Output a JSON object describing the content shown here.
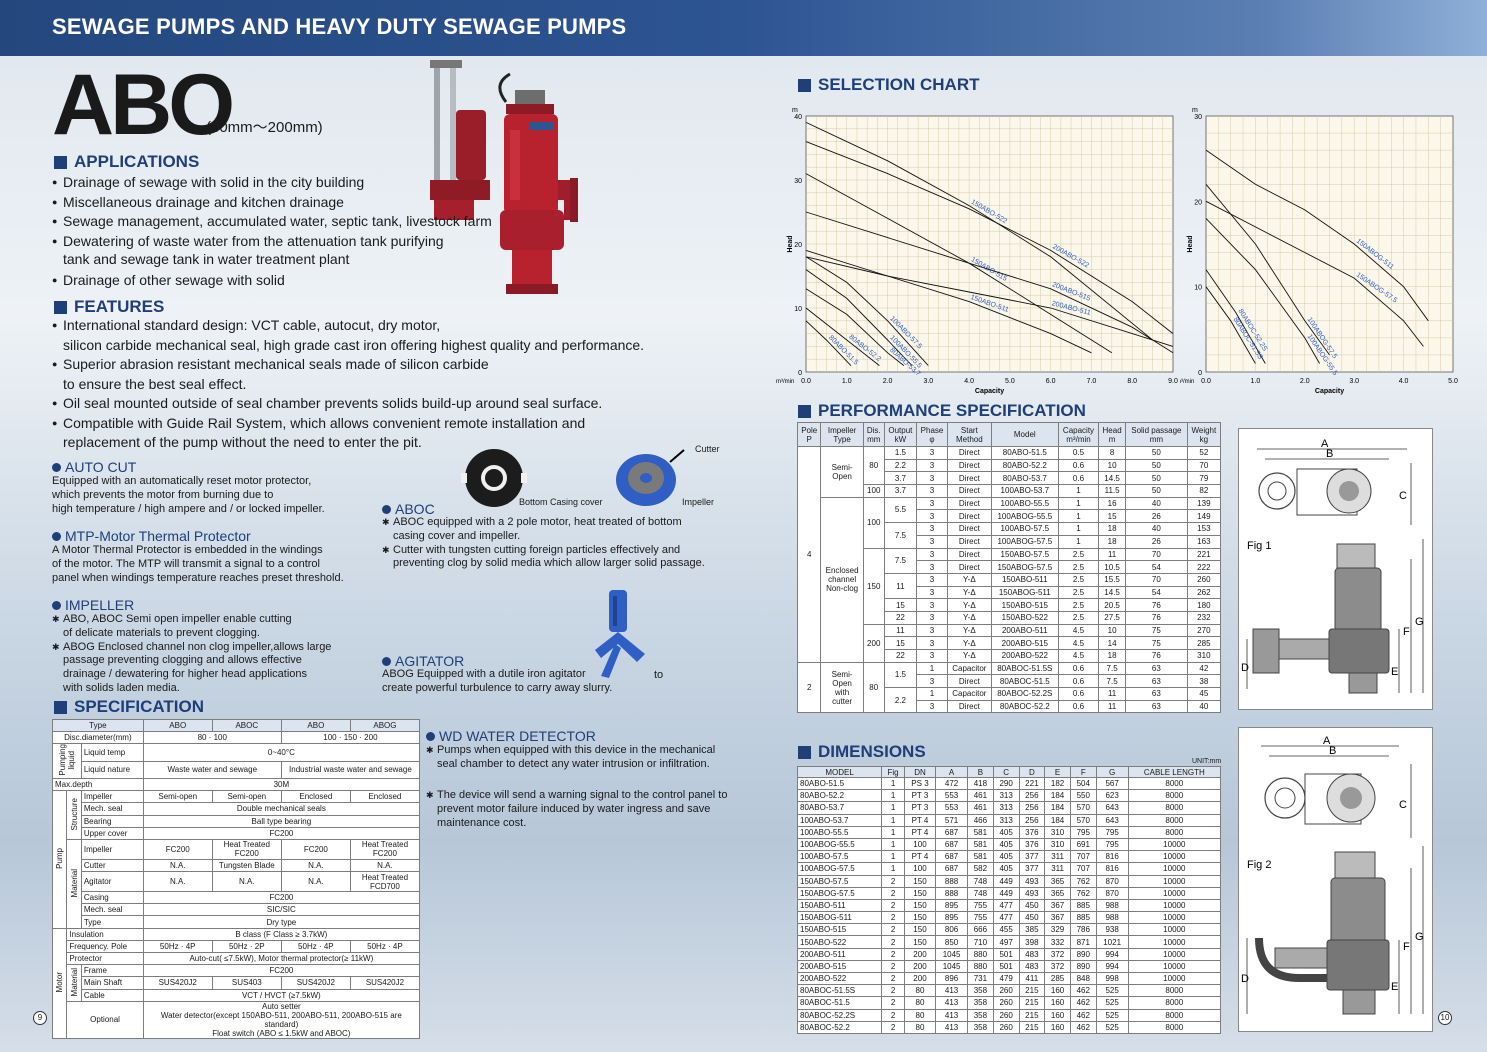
{
  "header": {
    "title": "SEWAGE PUMPS AND HEAVY DUTY SEWAGE PUMPS"
  },
  "model": {
    "name": "ABO",
    "range": "(80mm～200mm)"
  },
  "applications": {
    "title": "APPLICATIONS",
    "items": [
      "Drainage of sewage with solid in the city building",
      "Miscellaneous drainage and kitchen drainage",
      "Sewage management, accumulated water, septic tank, livestock farm",
      "Dewatering of waste water from the attenuation tank purifying",
      "Drainage of other sewage with solid"
    ],
    "item4_cont": "tank and sewage tank in water treatment plant"
  },
  "features": {
    "title": "FEATURES",
    "items": [
      "International standard design: VCT cable, autocut, dry motor,",
      "Superior abrasion resistant mechanical seals made of silicon carbide",
      "Oil seal mounted outside of seal chamber prevents solids build-up around seal surface.",
      "Compatible with Guide Rail System, which allows convenient remote installation and"
    ],
    "cont1": "silicon carbide mechanical seal, high grade cast iron offering highest quality and performance.",
    "cont2": "to ensure the best seal effect.",
    "cont4": "replacement of the pump without the need to enter the pit."
  },
  "autocut": {
    "title": "AUTO CUT",
    "lines": [
      "Equipped with an automatically reset motor protector,",
      "which prevents the motor from burning due to",
      "high temperature / high ampere and / or locked impeller."
    ]
  },
  "mtp": {
    "title": "MTP-Motor Thermal Protector",
    "lines": [
      "A Motor Thermal Protector is embedded in the windings",
      "of the motor. The MTP will transmit a signal to a control",
      "panel when windings temperature reaches preset threshold."
    ]
  },
  "impeller": {
    "title": "IMPELLER",
    "lines": [
      "ABO, ABOC Semi open impeller enable cutting",
      "of delicate materials to prevent clogging.",
      "ABOG Enclosed channel non clog impeller,allows large",
      "passage preventing clogging and allows effective",
      "drainage / dewatering for higher head applications",
      "with solids laden media."
    ]
  },
  "aboc": {
    "title": "ABOC",
    "lines": [
      "ABOC equipped with a 2 pole motor, heat treated of bottom",
      "casing cover and impeller.",
      "Cutter with tungsten cutting foreign particles effectively and",
      "preventing clog by solid media which allow larger solid passage."
    ],
    "label_cover": "Bottom Casing cover",
    "label_cutter": "Cutter",
    "label_impeller": "Impeller"
  },
  "agitator": {
    "title": "AGITATOR",
    "lines": [
      "ABOG Equipped with a dutile iron agitator",
      "create powerful turbulence to carry away slurry."
    ],
    "to": "to"
  },
  "wd": {
    "title": "WD WATER DETECTOR",
    "lines": [
      "Pumps when equipped with this device in the mechanical",
      "seal chamber to detect any water intrusion or infiltration.",
      "The device will send a warning signal to the control panel to",
      "prevent motor failure induced by water ingress and save",
      "maintenance cost."
    ]
  },
  "specification": {
    "title": "SPECIFICATION",
    "head": [
      "Type",
      "ABO",
      "ABOC",
      "ABO",
      "ABOG"
    ],
    "disc_label": "Disc.diameter(mm)",
    "disc_a": "80 · 100",
    "disc_b": "100 · 150 · 200",
    "pumping_liquid": "Pumping liquid",
    "liquid_temp": "Liquid temp",
    "liquid_temp_v": "0~40°C",
    "liquid_nature": "Liquid nature",
    "liquid_nature_a": "Waste water and sewage",
    "liquid_nature_b": "Industrial waste water and sewage",
    "max_depth": "Max.depth",
    "max_depth_v": "30M",
    "pump": "Pump",
    "structure": "Structure",
    "material": "Material",
    "impeller_s": "Impeller",
    "impeller_s_v": [
      "Semi-open",
      "Semi-open",
      "Enclosed",
      "Enclosed"
    ],
    "mech_seal": "Mech. seal",
    "mech_seal_v": "Double mechanical seals",
    "bearing": "Bearing",
    "bearing_v": "Ball type bearing",
    "upper_cover": "Upper cover",
    "upper_cover_v": "FC200",
    "impeller_m": "Impeller",
    "impeller_m_v": [
      "FC200",
      "Heat Treated FC200",
      "FC200",
      "Heat Treated FC200"
    ],
    "cutter": "Cutter",
    "cutter_v": [
      "N.A.",
      "Tungsten Blade",
      "N.A.",
      "N.A."
    ],
    "agitator_m": "Agitator",
    "agitator_m_v": [
      "N.A.",
      "N.A.",
      "N.A.",
      "Heat Treated FCD700"
    ],
    "casing": "Casing",
    "casing_v": "FC200",
    "mech_seal_m": "Mech. seal",
    "mech_seal_m_v": "SIC/SIC",
    "motor": "Motor",
    "type": "Type",
    "type_v": "Dry type",
    "insulation": "Insulation",
    "insulation_v": "B class (F Class ≥ 3.7kW)",
    "freq": "Frequency. Pole",
    "freq_v": [
      "50Hz · 4P",
      "50Hz · 2P",
      "50Hz · 4P",
      "50Hz · 4P"
    ],
    "protector": "Protector",
    "protector_v": "Auto-cut( ≤7.5kW), Motor thermal protector(≥ 11kW)",
    "frame": "Frame",
    "frame_v": "FC200",
    "main_shaft": "Main Shaft",
    "main_shaft_v": [
      "SUS420J2",
      "SUS403",
      "SUS420J2",
      "SUS420J2"
    ],
    "cable": "Cable",
    "cable_v": "VCT / HVCT (≥7.5kW)",
    "optional": "Optional",
    "optional_v": [
      "Auto setter",
      "Water detector(except 150ABO-511, 200ABO-511, 200ABO-515 are standard)",
      "Float switch (ABO ≤ 1.5kW and ABOC)"
    ]
  },
  "selection_chart": {
    "title": "SELECTION CHART"
  },
  "chart_data": [
    {
      "type": "line",
      "xlabel": "Capacity",
      "ylabel": "Head",
      "x_unit": "m³/min",
      "y_unit": "m",
      "xlim": [
        0,
        9
      ],
      "ylim": [
        0,
        40
      ],
      "x_ticks": [
        "0.0",
        "1.0",
        "2.0",
        "3.0",
        "4.0",
        "5.0",
        "6.0",
        "7.0",
        "8.0",
        "9.0"
      ],
      "y_ticks": [
        "0",
        "10",
        "20",
        "30",
        "40"
      ],
      "series": [
        {
          "name": "150ABO-522",
          "x": [
            0,
            2,
            4,
            6,
            8.5
          ],
          "y": [
            39,
            33,
            26,
            18,
            5
          ]
        },
        {
          "name": "200ABO-522",
          "x": [
            0,
            2,
            4,
            6,
            8,
            9
          ],
          "y": [
            36,
            31,
            25.5,
            19,
            11,
            6
          ]
        },
        {
          "name": "150ABO-515",
          "x": [
            0,
            2,
            4,
            6,
            7.5
          ],
          "y": [
            31,
            24,
            17,
            9,
            3
          ]
        },
        {
          "name": "200ABO-515",
          "x": [
            0,
            2,
            4,
            6,
            8,
            9
          ],
          "y": [
            25,
            21,
            17,
            13,
            7,
            3
          ]
        },
        {
          "name": "200ABO-511",
          "x": [
            0,
            2,
            4,
            6,
            8,
            9
          ],
          "y": [
            18,
            15,
            12.5,
            10,
            6,
            4
          ]
        },
        {
          "name": "150ABO-511",
          "x": [
            0,
            2,
            4,
            6,
            7
          ],
          "y": [
            19,
            15,
            11,
            6,
            3
          ]
        },
        {
          "name": "100ABO-57.5",
          "x": [
            0,
            1,
            2,
            3
          ],
          "y": [
            18,
            14,
            8,
            1
          ]
        },
        {
          "name": "100ABO-55.5",
          "x": [
            0,
            1,
            2,
            2.6
          ],
          "y": [
            16,
            11.5,
            5,
            1
          ]
        },
        {
          "name": "80ABO-53.7",
          "x": [
            0,
            1,
            2,
            2.4
          ],
          "y": [
            13,
            9,
            3,
            1
          ]
        },
        {
          "name": "80ABO-52.2",
          "x": [
            0,
            1,
            1.8
          ],
          "y": [
            10,
            5,
            1
          ]
        },
        {
          "name": "80ABO-51.5",
          "x": [
            0,
            0.5,
            1.1
          ],
          "y": [
            8,
            5,
            1
          ]
        }
      ]
    },
    {
      "type": "line",
      "xlabel": "Capacity",
      "ylabel": "Head",
      "x_unit": "m³/min",
      "y_unit": "m",
      "xlim": [
        0,
        5
      ],
      "ylim": [
        0,
        30
      ],
      "x_ticks": [
        "0.0",
        "1.0",
        "2.0",
        "3.0",
        "4.0",
        "5.0"
      ],
      "y_ticks": [
        "0",
        "10",
        "20",
        "30"
      ],
      "series": [
        {
          "name": "150ABOG-511",
          "x": [
            0,
            1,
            2,
            3,
            4,
            4.5
          ],
          "y": [
            26,
            22,
            19,
            15,
            10,
            6
          ]
        },
        {
          "name": "150ABOG-57.5",
          "x": [
            0,
            1,
            2,
            3,
            4,
            4.4
          ],
          "y": [
            20,
            17,
            14,
            11,
            6,
            3
          ]
        },
        {
          "name": "100ABOG-57.5",
          "x": [
            0,
            1,
            2,
            2.5
          ],
          "y": [
            22,
            15,
            6,
            2
          ]
        },
        {
          "name": "100ABOG-55.5",
          "x": [
            0,
            1,
            2,
            2.3
          ],
          "y": [
            18,
            12,
            4,
            1
          ]
        },
        {
          "name": "80ABOC-52.2S",
          "x": [
            0,
            0.6,
            1.2
          ],
          "y": [
            12,
            7,
            1
          ]
        },
        {
          "name": "80ABOC-51.5S",
          "x": [
            0,
            0.5,
            1.0
          ],
          "y": [
            10,
            6,
            1
          ]
        }
      ]
    }
  ],
  "performance": {
    "title": "PERFORMANCE SPECIFICATION",
    "headers": [
      [
        "Pole",
        "P"
      ],
      [
        "Impeller",
        "Type"
      ],
      [
        "Dis.",
        "mm"
      ],
      [
        "Output",
        "kW"
      ],
      [
        "Phase",
        "φ"
      ],
      [
        "Start",
        "Method"
      ],
      [
        "Model",
        ""
      ],
      [
        "Capacity",
        "m³/min"
      ],
      [
        "Head",
        "m"
      ],
      [
        "Solid passage",
        "mm"
      ],
      [
        "Weight",
        "kg"
      ]
    ],
    "pole4": "4",
    "pole2": "2",
    "semi_open": [
      "Semi-",
      "Open"
    ],
    "enclosed": [
      "Enclosed",
      "channel",
      "Non-clog"
    ],
    "semi_open_cutter": [
      "Semi-",
      "Open",
      "with",
      "cutter"
    ],
    "rows": [
      [
        "1.5",
        "3",
        "Direct",
        "80ABO-51.5",
        "0.5",
        "8",
        "50",
        "52"
      ],
      [
        "2.2",
        "3",
        "Direct",
        "80ABO-52.2",
        "0.6",
        "10",
        "50",
        "70"
      ],
      [
        "3.7",
        "3",
        "Direct",
        "80ABO-53.7",
        "0.6",
        "14.5",
        "50",
        "79"
      ],
      [
        "3.7",
        "3",
        "Direct",
        "100ABO-53.7",
        "1",
        "11.5",
        "50",
        "82"
      ],
      [
        "",
        "3",
        "Direct",
        "100ABO-55.5",
        "1",
        "16",
        "40",
        "139"
      ],
      [
        "",
        "3",
        "Direct",
        "100ABOG-55.5",
        "1",
        "15",
        "26",
        "149"
      ],
      [
        "",
        "3",
        "Direct",
        "100ABO-57.5",
        "1",
        "18",
        "40",
        "153"
      ],
      [
        "",
        "3",
        "Direct",
        "100ABOG-57.5",
        "1",
        "18",
        "26",
        "163"
      ],
      [
        "",
        "3",
        "Direct",
        "150ABO-57.5",
        "2.5",
        "11",
        "70",
        "221"
      ],
      [
        "",
        "3",
        "Direct",
        "150ABOG-57.5",
        "2.5",
        "10.5",
        "54",
        "222"
      ],
      [
        "",
        "3",
        "Y-Δ",
        "150ABO-511",
        "2.5",
        "15.5",
        "70",
        "260"
      ],
      [
        "",
        "3",
        "Y-Δ",
        "150ABOG-511",
        "2.5",
        "14.5",
        "54",
        "262"
      ],
      [
        "15",
        "3",
        "Y-Δ",
        "150ABO-515",
        "2.5",
        "20.5",
        "76",
        "180"
      ],
      [
        "22",
        "3",
        "Y-Δ",
        "150ABO-522",
        "2.5",
        "27.5",
        "76",
        "232"
      ],
      [
        "11",
        "3",
        "Y-Δ",
        "200ABO-511",
        "4.5",
        "10",
        "75",
        "270"
      ],
      [
        "15",
        "3",
        "Y-Δ",
        "200ABO-515",
        "4.5",
        "14",
        "75",
        "285"
      ],
      [
        "22",
        "3",
        "Y-Δ",
        "200ABO-522",
        "4.5",
        "18",
        "76",
        "310"
      ],
      [
        "",
        "1",
        "Capacitor",
        "80ABOC-51.5S",
        "0.6",
        "7.5",
        "63",
        "42"
      ],
      [
        "",
        "3",
        "Direct",
        "80ABOC-51.5",
        "0.6",
        "7.5",
        "63",
        "38"
      ],
      [
        "",
        "1",
        "Capacitor",
        "80ABOC-52.2S",
        "0.6",
        "11",
        "63",
        "45"
      ],
      [
        "",
        "3",
        "Direct",
        "80ABOC-52.2",
        "0.6",
        "11",
        "63",
        "40"
      ]
    ],
    "dis_80": "80",
    "dis_100": "100",
    "dis_150": "150",
    "dis_200": "200",
    "out_55": "5.5",
    "out_75": "7.5",
    "out_75b": "7.5",
    "out_11": "11",
    "out_15c": "1.5",
    "out_22c": "2.2"
  },
  "dimensions": {
    "title": "DIMENSIONS",
    "unit": "UNIT:mm",
    "headers": [
      "MODEL",
      "Fig",
      "DN",
      "A",
      "B",
      "C",
      "D",
      "E",
      "F",
      "G",
      "CABLE LENGTH"
    ],
    "rows": [
      [
        "80ABO-51.5",
        "1",
        "PS 3",
        "472",
        "418",
        "290",
        "221",
        "182",
        "504",
        "567",
        "8000"
      ],
      [
        "80ABO-52.2",
        "1",
        "PT 3",
        "553",
        "461",
        "313",
        "256",
        "184",
        "550",
        "623",
        "8000"
      ],
      [
        "80ABO-53.7",
        "1",
        "PT 3",
        "553",
        "461",
        "313",
        "256",
        "184",
        "570",
        "643",
        "8000"
      ],
      [
        "100ABO-53.7",
        "1",
        "PT 4",
        "571",
        "466",
        "313",
        "256",
        "184",
        "570",
        "643",
        "8000"
      ],
      [
        "100ABO-55.5",
        "1",
        "PT 4",
        "687",
        "581",
        "405",
        "376",
        "310",
        "795",
        "795",
        "8000"
      ],
      [
        "100ABOG-55.5",
        "1",
        "100",
        "687",
        "581",
        "405",
        "376",
        "310",
        "691",
        "795",
        "10000"
      ],
      [
        "100ABO-57.5",
        "1",
        "PT 4",
        "687",
        "581",
        "405",
        "377",
        "311",
        "707",
        "816",
        "10000"
      ],
      [
        "100ABOG-57.5",
        "1",
        "100",
        "687",
        "582",
        "405",
        "377",
        "311",
        "707",
        "816",
        "10000"
      ],
      [
        "150ABO-57.5",
        "2",
        "150",
        "888",
        "748",
        "449",
        "493",
        "365",
        "762",
        "870",
        "10000"
      ],
      [
        "150ABOG-57.5",
        "2",
        "150",
        "888",
        "748",
        "449",
        "493",
        "365",
        "762",
        "870",
        "10000"
      ],
      [
        "150ABO-511",
        "2",
        "150",
        "895",
        "755",
        "477",
        "450",
        "367",
        "885",
        "988",
        "10000"
      ],
      [
        "150ABOG-511",
        "2",
        "150",
        "895",
        "755",
        "477",
        "450",
        "367",
        "885",
        "988",
        "10000"
      ],
      [
        "150ABO-515",
        "2",
        "150",
        "806",
        "666",
        "455",
        "385",
        "329",
        "786",
        "938",
        "10000"
      ],
      [
        "150ABO-522",
        "2",
        "150",
        "850",
        "710",
        "497",
        "398",
        "332",
        "871",
        "1021",
        "10000"
      ],
      [
        "200ABO-511",
        "2",
        "200",
        "1045",
        "880",
        "501",
        "483",
        "372",
        "890",
        "994",
        "10000"
      ],
      [
        "200ABO-515",
        "2",
        "200",
        "1045",
        "880",
        "501",
        "483",
        "372",
        "890",
        "994",
        "10000"
      ],
      [
        "200ABO-522",
        "2",
        "200",
        "896",
        "731",
        "479",
        "411",
        "285",
        "848",
        "998",
        "10000"
      ],
      [
        "80ABOC-51.5S",
        "2",
        "80",
        "413",
        "358",
        "260",
        "215",
        "160",
        "462",
        "525",
        "8000"
      ],
      [
        "80ABOC-51.5",
        "2",
        "80",
        "413",
        "358",
        "260",
        "215",
        "160",
        "462",
        "525",
        "8000"
      ],
      [
        "80ABOC-52.2S",
        "2",
        "80",
        "413",
        "358",
        "260",
        "215",
        "160",
        "462",
        "525",
        "8000"
      ],
      [
        "80ABOC-52.2",
        "2",
        "80",
        "413",
        "358",
        "260",
        "215",
        "160",
        "462",
        "525",
        "8000"
      ]
    ]
  },
  "figures": {
    "fig1": "Fig 1",
    "fig2": "Fig 2",
    "labels": [
      "A",
      "B",
      "C",
      "D",
      "E",
      "F",
      "G"
    ]
  },
  "pages": {
    "left": "9",
    "right": "10"
  },
  "colors": {
    "brand": "#1e3f78",
    "pump_red": "#b8222e",
    "agitator_blue": "#2f5fc4"
  }
}
